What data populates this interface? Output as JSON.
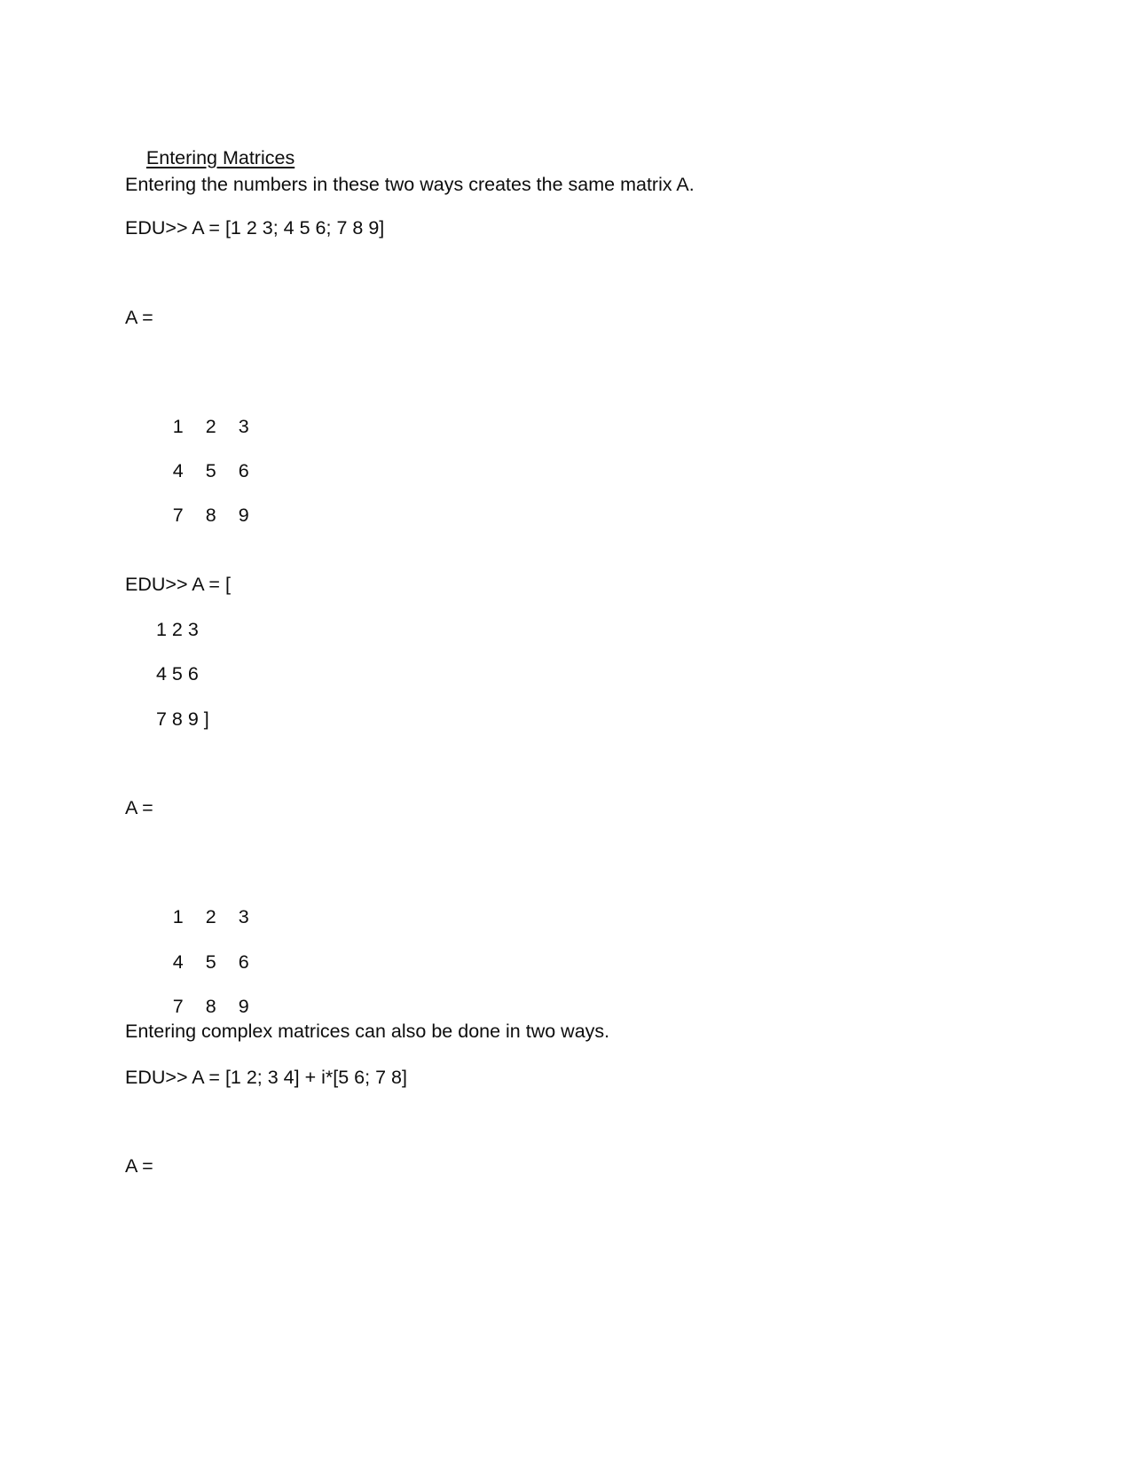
{
  "document": {
    "heading": "Entering Matrices",
    "intro_paragraph": "Entering the numbers in these two ways creates the same matrix A.",
    "command_1": "EDU>> A = [1 2 3; 4 5 6; 7 8 9]",
    "output_label_1": "A =",
    "matrix_1": {
      "rows": [
        [
          "1",
          "2",
          "3"
        ],
        [
          "4",
          "5",
          "6"
        ],
        [
          "7",
          "8",
          "9"
        ]
      ]
    },
    "command_2_open": "EDU>> A = [",
    "command_2_rows": [
      "1 2 3",
      "4 5 6",
      "7 8 9 ]"
    ],
    "output_label_2": "A =",
    "matrix_2": {
      "rows": [
        [
          "1",
          "2",
          "3"
        ],
        [
          "4",
          "5",
          "6"
        ],
        [
          "7",
          "8",
          "9"
        ]
      ]
    },
    "complex_paragraph": "Entering complex matrices can also be done in two ways.",
    "command_3": "EDU>> A = [1 2; 3 4] + i*[5 6; 7 8]",
    "output_label_3": "A ="
  }
}
